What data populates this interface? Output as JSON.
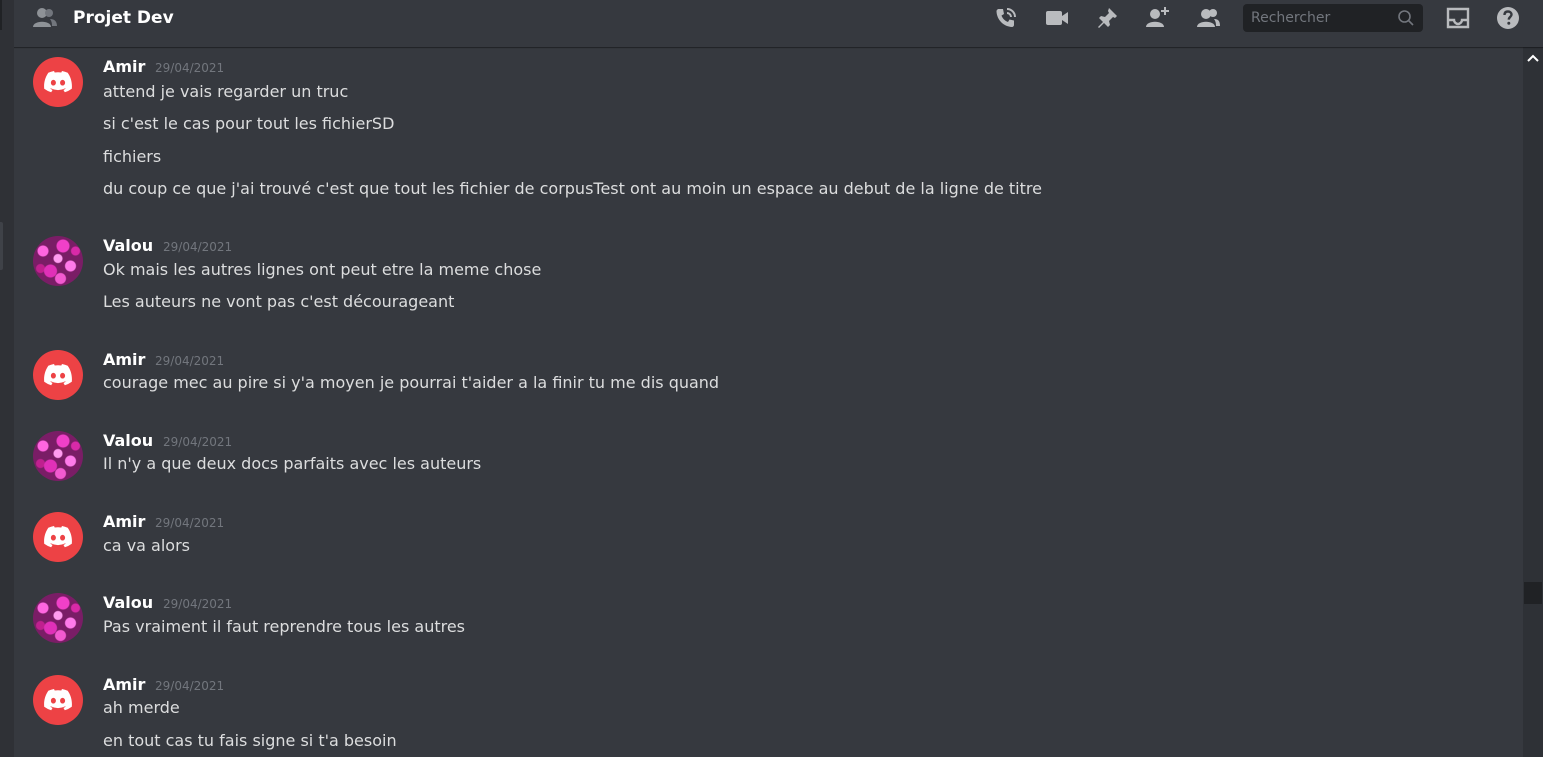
{
  "header": {
    "title": "Projet Dev",
    "search_placeholder": "Rechercher",
    "icons": [
      "call-icon",
      "video-icon",
      "pin-icon",
      "add-member-icon",
      "members-icon",
      "search-icon",
      "inbox-icon",
      "help-icon"
    ]
  },
  "colors": {
    "background": "#36393f",
    "header_bg": "#36393f",
    "search_bg": "#202225",
    "accent_red": "#ed4245",
    "username": "#ffffff",
    "timestamp": "#72767d",
    "text": "#dcddde"
  },
  "messages": [
    {
      "author": "Amir",
      "timestamp": "29/04/2021",
      "avatar": "discord-logo",
      "lines": [
        "attend je vais regarder un truc",
        "si c'est le cas pour tout les fichierSD",
        "fichiers",
        "du coup ce que j'ai trouvé c'est que tout les fichier de corpusTest ont au moin un espace au debut de la ligne de titre"
      ]
    },
    {
      "author": "Valou",
      "timestamp": "29/04/2021",
      "avatar": "flowers",
      "lines": [
        "Ok mais les autres lignes ont peut etre la meme chose",
        "Les auteurs ne vont pas c'est décourageant"
      ]
    },
    {
      "author": "Amir",
      "timestamp": "29/04/2021",
      "avatar": "discord-logo",
      "lines": [
        "courage mec au pire si y'a moyen je pourrai t'aider a la finir tu me dis quand"
      ]
    },
    {
      "author": "Valou",
      "timestamp": "29/04/2021",
      "avatar": "flowers",
      "lines": [
        "Il n'y a que deux docs parfaits avec les auteurs"
      ]
    },
    {
      "author": "Amir",
      "timestamp": "29/04/2021",
      "avatar": "discord-logo",
      "lines": [
        "ca va alors"
      ]
    },
    {
      "author": "Valou",
      "timestamp": "29/04/2021",
      "avatar": "flowers",
      "lines": [
        "Pas vraiment il faut reprendre tous les autres"
      ]
    },
    {
      "author": "Amir",
      "timestamp": "29/04/2021",
      "avatar": "discord-logo",
      "lines": [
        "ah merde",
        "en tout cas tu fais signe si t'a besoin"
      ]
    }
  ]
}
